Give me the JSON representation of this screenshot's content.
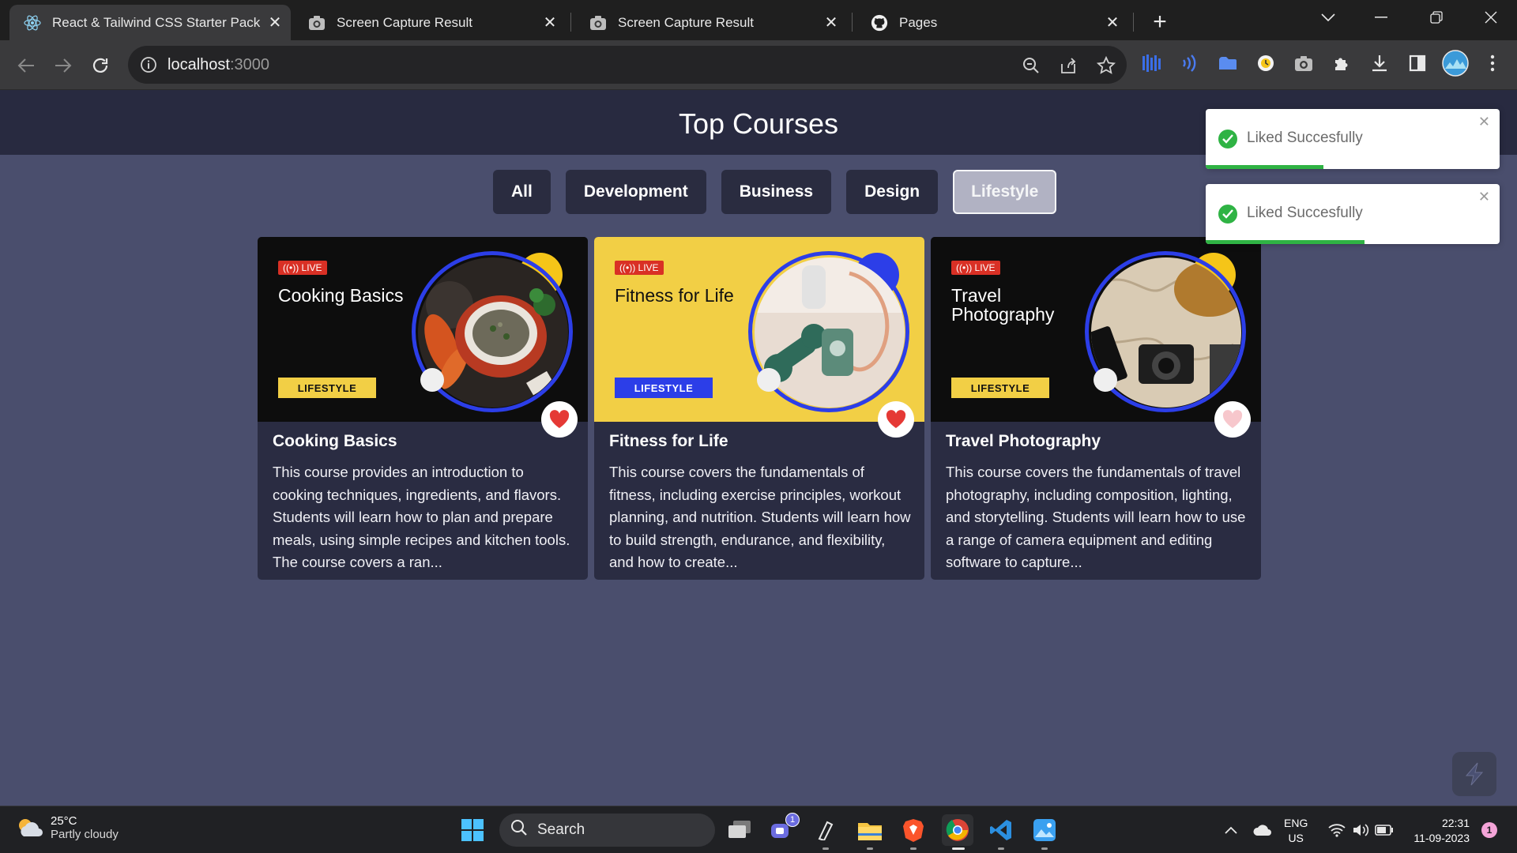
{
  "browser": {
    "tabs": [
      {
        "title": "React & Tailwind CSS Starter Pack",
        "icon": "react-icon",
        "active": true
      },
      {
        "title": "Screen Capture Result",
        "icon": "camera-icon",
        "active": false
      },
      {
        "title": "Screen Capture Result",
        "icon": "camera-icon",
        "active": false
      },
      {
        "title": "Pages",
        "icon": "github-icon",
        "active": false
      }
    ],
    "url_host": "localhost",
    "url_port": ":3000"
  },
  "page": {
    "title": "Top Courses",
    "filters": [
      "All",
      "Development",
      "Business",
      "Design",
      "Lifestyle"
    ],
    "active_filter": "Lifestyle"
  },
  "courses": [
    {
      "thumb_title": "Cooking Basics",
      "live": "LIVE",
      "tag": "LIFESTYLE",
      "name": "Cooking Basics",
      "description": "This course provides an introduction to cooking techniques, ingredients, and flavors. Students will learn how to plan and prepare meals, using simple recipes and kitchen tools. The course covers a ran...",
      "liked": true,
      "thumb_bg": "#0d0d0d",
      "accent": "#f5c518"
    },
    {
      "thumb_title": "Fitness for Life",
      "live": "LIVE",
      "tag": "LIFESTYLE",
      "name": "Fitness for Life",
      "description": "This course covers the fundamentals of fitness, including exercise principles, workout planning, and nutrition. Students will learn how to build strength, endurance, and flexibility, and how to create...",
      "liked": true,
      "thumb_bg": "#f2cf45",
      "accent": "#2c3ee8"
    },
    {
      "thumb_title": "Travel Photography",
      "live": "LIVE",
      "tag": "LIFESTYLE",
      "name": "Travel Photography",
      "description": "This course covers the fundamentals of travel photography, including composition, lighting, and storytelling. Students will learn how to use a range of camera equipment and editing software to capture...",
      "liked": false,
      "thumb_bg": "#0d0d0d",
      "accent": "#f5c518"
    }
  ],
  "toasts": [
    {
      "message": "Liked Succesfully",
      "progress": 0.4
    },
    {
      "message": "Liked Succesfully",
      "progress": 0.54
    }
  ],
  "taskbar": {
    "weather_temp": "25°C",
    "weather_desc": "Partly cloudy",
    "search_label": "Search",
    "teams_badge": "1",
    "lang_top": "ENG",
    "lang_bottom": "US",
    "time": "22:31",
    "date": "11-09-2023",
    "notification_count": "1"
  },
  "colors": {
    "page_bg": "#4a4e6d",
    "header_band": "#282a40",
    "card_bg": "#2a2c42",
    "like_red": "#e53935",
    "like_pink": "#f7c7cc",
    "toast_green": "#2fb344"
  }
}
